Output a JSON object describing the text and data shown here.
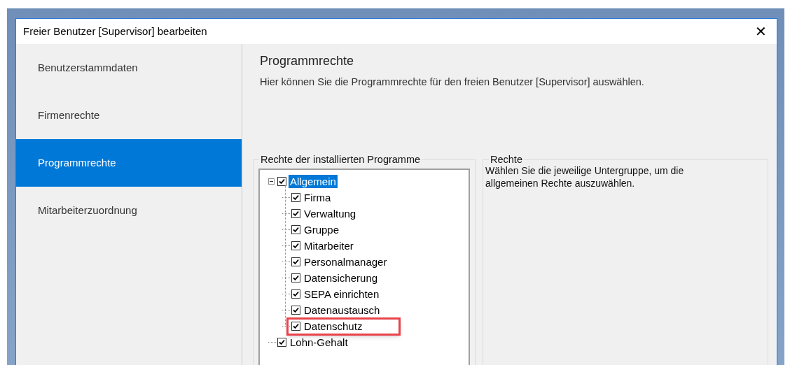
{
  "window": {
    "title": "Freier Benutzer [Supervisor] bearbeiten",
    "close": "✕"
  },
  "sidebar": {
    "items": [
      {
        "label": "Benutzerstammdaten",
        "selected": false
      },
      {
        "label": "Firmenrechte",
        "selected": false
      },
      {
        "label": "Programmrechte",
        "selected": true
      },
      {
        "label": "Mitarbeiterzuordnung",
        "selected": false
      }
    ]
  },
  "content": {
    "title": "Programmrechte",
    "subtitle": "Hier können Sie die Programmrechte für den freien Benutzer [Supervisor] auswählen.",
    "programs_group": {
      "title": "Rechte der installierten Programme",
      "tree": [
        {
          "label": "Allgemein",
          "checked": true,
          "selected": true,
          "expanded": true,
          "highlighted": false,
          "children": [
            {
              "label": "Firma",
              "checked": true,
              "selected": false,
              "highlighted": false
            },
            {
              "label": "Verwaltung",
              "checked": true,
              "selected": false,
              "highlighted": false
            },
            {
              "label": "Gruppe",
              "checked": true,
              "selected": false,
              "highlighted": false
            },
            {
              "label": "Mitarbeiter",
              "checked": true,
              "selected": false,
              "highlighted": false
            },
            {
              "label": "Personalmanager",
              "checked": true,
              "selected": false,
              "highlighted": false
            },
            {
              "label": "Datensicherung",
              "checked": true,
              "selected": false,
              "highlighted": false
            },
            {
              "label": "SEPA einrichten",
              "checked": true,
              "selected": false,
              "highlighted": false
            },
            {
              "label": "Datenaustausch",
              "checked": true,
              "selected": false,
              "highlighted": false
            },
            {
              "label": "Datenschutz",
              "checked": true,
              "selected": false,
              "highlighted": true
            }
          ]
        },
        {
          "label": "Lohn-Gehalt",
          "checked": true,
          "selected": false,
          "highlighted": false
        }
      ]
    },
    "rights_group": {
      "title": "Rechte",
      "text": "Wählen Sie die jeweilige Untergruppe, um die allgemeinen Rechte auszuwählen."
    }
  }
}
